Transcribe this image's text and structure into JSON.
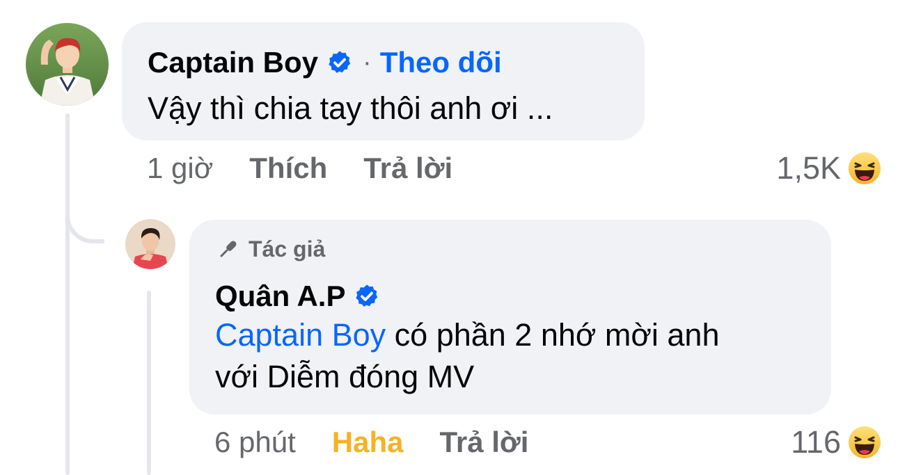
{
  "thread": {
    "comment": {
      "author": "Captain Boy",
      "verified": true,
      "separator": "·",
      "follow_label": "Theo dõi",
      "text": "Vậy thì chia tay thôi anh ơi ...",
      "time": "1 giờ",
      "like_label": "Thích",
      "reply_label": "Trả lời",
      "reaction_count": "1,5K",
      "reaction_icon": "haha-emoji-icon"
    },
    "reply": {
      "badge_label": "Tác giả",
      "badge_icon": "microphone-icon",
      "author": "Quân A.P",
      "verified": true,
      "mention": "Captain Boy",
      "text_line1_rest": " có phần 2 nhớ mời anh",
      "text_line2": "với Diễm đóng MV",
      "time": "6 phút",
      "reaction_label": "Haha",
      "reply_label": "Trả lời",
      "reaction_count": "116",
      "reaction_icon": "haha-emoji-icon"
    }
  },
  "colors": {
    "bubble_bg": "#f0f2f5",
    "link_blue": "#0866ff",
    "secondary_text": "#65676b",
    "haha_yellow": "#f7b125",
    "thread_line": "#e4e6eb"
  }
}
